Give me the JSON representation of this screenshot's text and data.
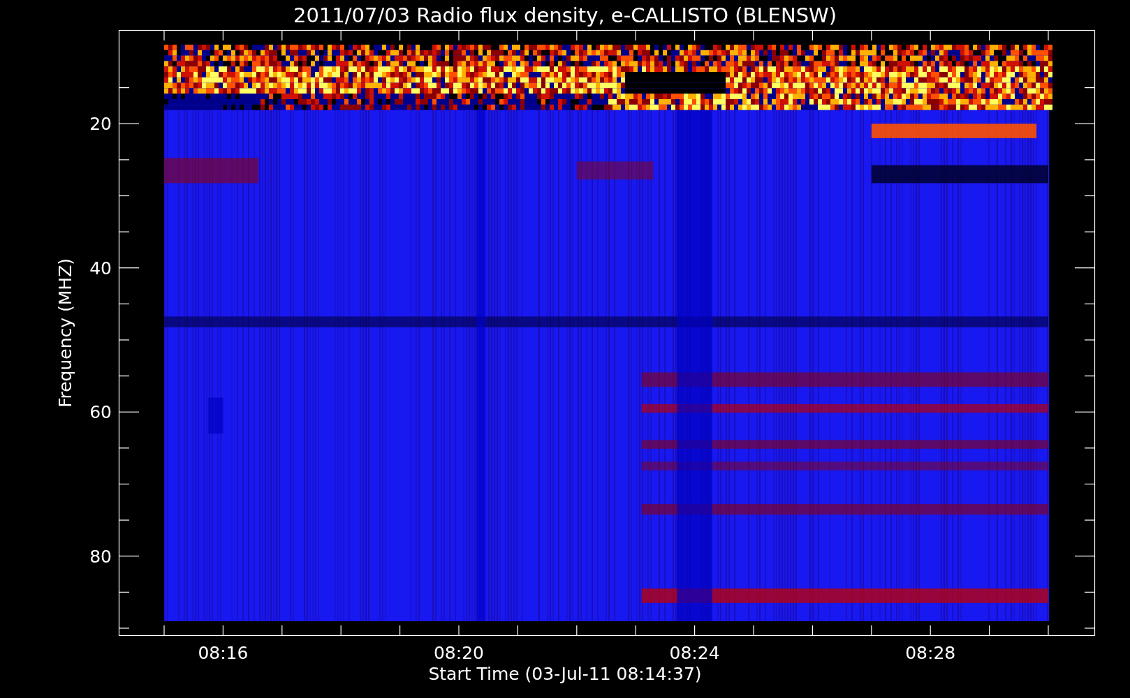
{
  "title": "2011/07/03  Radio flux density, e-CALLISTO (BLENSW)",
  "y_axis": {
    "label": "Frequency (MHZ)",
    "ticks": [
      "20",
      "40",
      "60",
      "80"
    ]
  },
  "x_axis": {
    "label": "Start Time (03-Jul-11 08:14:37)",
    "ticks": [
      "08:16",
      "08:20",
      "08:24",
      "08:28"
    ]
  }
}
